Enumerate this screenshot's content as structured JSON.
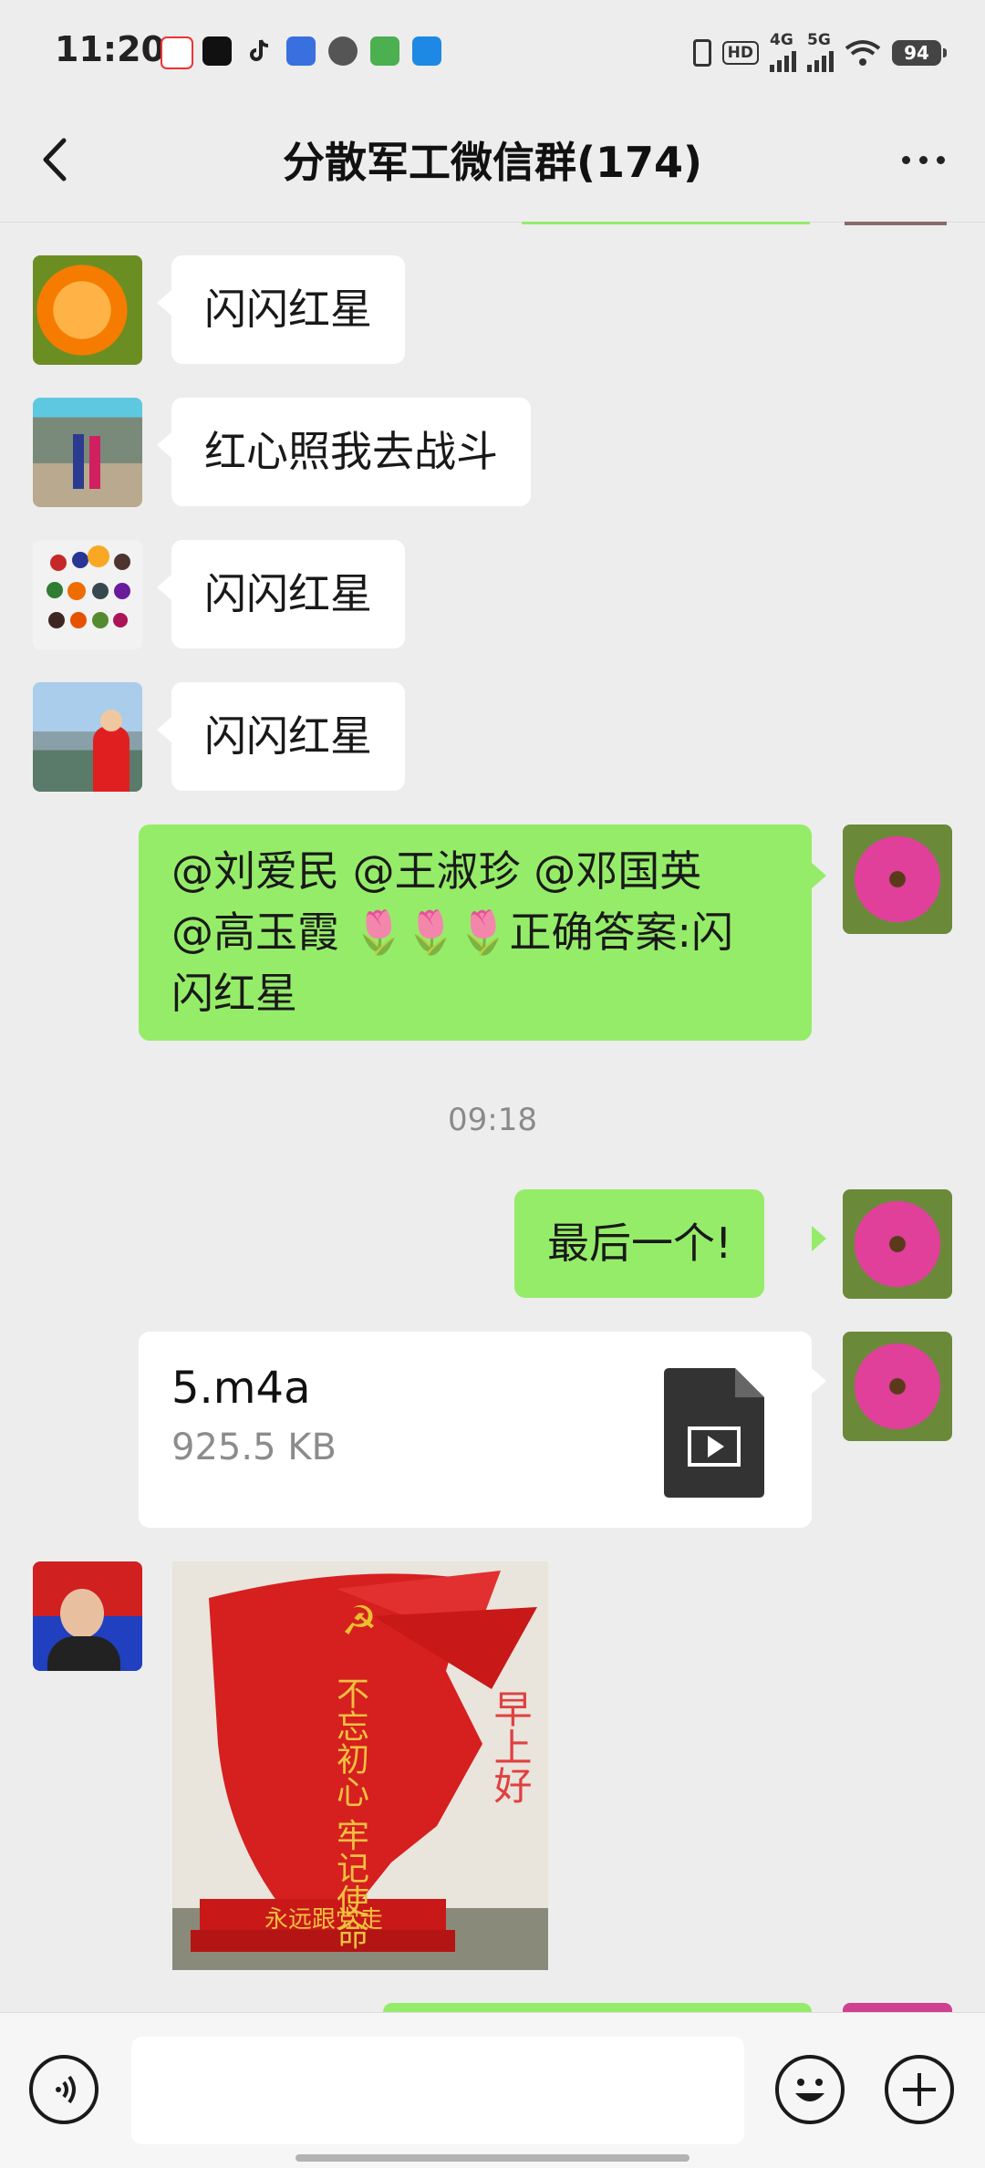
{
  "status_bar": {
    "time": "11:20",
    "signal_4g": "4G",
    "signal_5g": "5G",
    "hd": "HD",
    "battery": "94",
    "notification_icons": [
      "location-pin-icon",
      "capcut-icon",
      "tiktok-icon",
      "baidu-icon",
      "message-icon",
      "video-icon",
      "bookmark-icon"
    ]
  },
  "header": {
    "title": "分散军工微信群(174)"
  },
  "messages": [
    {
      "sender": "other",
      "text": "闪闪红星"
    },
    {
      "sender": "other",
      "text": "红心照我去战斗"
    },
    {
      "sender": "other",
      "text": "闪闪红星"
    },
    {
      "sender": "other",
      "text": "闪闪红星"
    },
    {
      "sender": "me",
      "line1": "@刘爱民 @王淑珍 @邓国英",
      "line2": "@高玉霞 🌷🌷🌷正确答案:闪",
      "line3": "闪红星"
    },
    {
      "timestamp": "09:18"
    },
    {
      "sender": "me",
      "text": "最后一个!"
    },
    {
      "sender": "me",
      "file": {
        "name": "5.m4a",
        "size": "925.5 KB"
      }
    },
    {
      "sender": "other",
      "image": {
        "caption_left": "不忘初心 牢记使命",
        "caption_right": "早上好",
        "base": "永远跟党走"
      }
    }
  ],
  "colors": {
    "outgoing_bubble": "#95ec69",
    "incoming_bubble": "#ffffff",
    "background": "#ededed"
  }
}
